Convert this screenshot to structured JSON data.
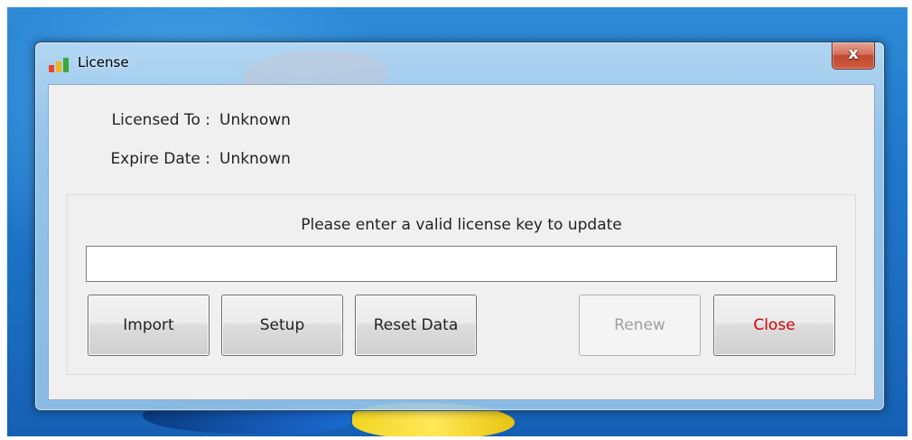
{
  "window": {
    "title": "License",
    "app_icon": "bar-chart-app-icon",
    "close_glyph": "x"
  },
  "license_info": {
    "licensed_to_label": "Licensed To :",
    "licensed_to_value": "Unknown",
    "expire_date_label": "Expire Date :",
    "expire_date_value": "Unknown"
  },
  "update": {
    "prompt": "Please enter a valid license key to update",
    "key_value": "",
    "key_placeholder": ""
  },
  "buttons": {
    "import": "Import",
    "setup": "Setup",
    "reset_data": "Reset Data",
    "renew": "Renew",
    "close": "Close"
  },
  "colors": {
    "close_text": "#d40000",
    "disabled_text": "#a0a0a0",
    "titlebar_close_bg": "#c04a32"
  }
}
